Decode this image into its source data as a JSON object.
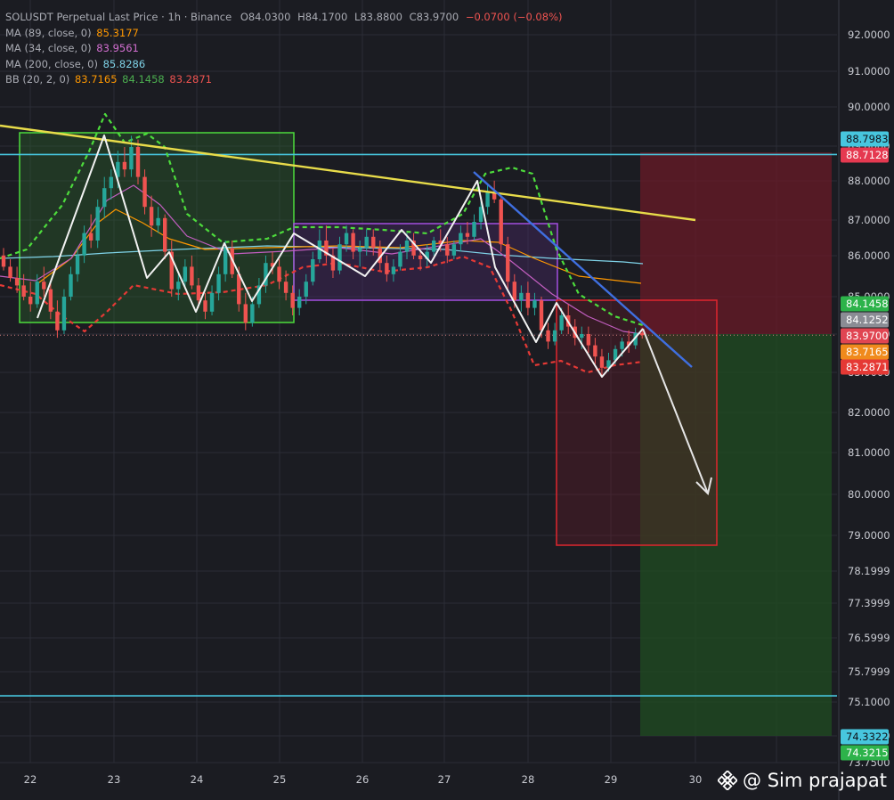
{
  "legend": {
    "title": "SOLUSDT Perpetual Last Price · 1h · Binance",
    "open": "O84.0300",
    "high": "H84.1700",
    "low": "L83.8800",
    "close": "C83.9700",
    "change": "−0.0700 (−0.08%)",
    "ma89_label": "MA (89, close, 0)",
    "ma89_value": "85.3177",
    "ma34_label": "MA (34, close, 0)",
    "ma34_value": "83.9561",
    "ma200_label": "MA (200, close, 0)",
    "ma200_value": "85.8286",
    "bb_label": "BB (20, 2, 0)",
    "bb_basis": "83.7165",
    "bb_upper": "84.1458",
    "bb_lower": "83.2871"
  },
  "watermark": {
    "icon": "binance-logo-icon",
    "text": "@ Sim prajapat"
  },
  "colors": {
    "background": "#1b1c22",
    "grid": "#2b2d36",
    "up": "#26a69a",
    "down": "#ef5350",
    "ma89": "#ff9800",
    "ma34": "#c25ec0",
    "ma200": "#7fd3e8",
    "bb_upper": "#4caf50",
    "bb_lower": "#e53935",
    "trend_yellow": "#e8dc4a",
    "trend_blue": "#3f6fe0",
    "level_cyan": "#47c6de"
  },
  "chart_data": {
    "type": "candlestick",
    "symbol": "SOLUSDT Perpetual",
    "interval": "1h",
    "exchange": "Binance",
    "ylim": [
      73.75,
      92.5
    ],
    "y_ticks": [
      "92.0000",
      "91.0000",
      "90.0000",
      "89.0000",
      "88.0000",
      "87.0000",
      "86.0000",
      "85.0000",
      "84.0000",
      "83.0000",
      "82.0000",
      "81.0000",
      "80.0000",
      "79.0000",
      "78.1999",
      "77.3999",
      "76.5999",
      "75.7999",
      "75.1000",
      "74.3000",
      "73.7500"
    ],
    "x_ticks": [
      "22",
      "23",
      "24",
      "25",
      "26",
      "27",
      "28",
      "29",
      "30"
    ],
    "price_tags": [
      {
        "label": "88.7983",
        "price": 88.7983,
        "color": "#47c6de",
        "text_color": "#10131a"
      },
      {
        "label": "88.7128",
        "price": 88.7128,
        "color": "#e53950",
        "text_color": "#ffffff"
      },
      {
        "label": "84.1458",
        "price": 84.1458,
        "color": "#2db34a",
        "text_color": "#ffffff"
      },
      {
        "label": "84.1252",
        "price": 84.1252,
        "color": "#8a8c94",
        "text_color": "#ffffff"
      },
      {
        "label": "83.9700",
        "price": 83.97,
        "color": "#e04552",
        "text_color": "#ffffff"
      },
      {
        "label": "83.7165",
        "price": 83.7165,
        "color": "#f08a1c",
        "text_color": "#ffffff"
      },
      {
        "label": "83.2871",
        "price": 83.2871,
        "color": "#e53935",
        "text_color": "#ffffff"
      },
      {
        "label": "74.3322",
        "price": 74.3322,
        "color": "#47c6de",
        "text_color": "#10131a"
      },
      {
        "label": "74.3215",
        "price": 74.3215,
        "color": "#2db34a",
        "text_color": "#ffffff"
      }
    ],
    "horizontal_levels": [
      88.7983,
      74.3322
    ],
    "last_price": 83.97,
    "candles": [
      [
        86.1,
        86.3,
        85.7,
        85.8
      ],
      [
        85.8,
        86.0,
        85.4,
        85.5
      ],
      [
        85.5,
        85.8,
        85.1,
        85.3
      ],
      [
        85.3,
        85.6,
        84.9,
        85.0
      ],
      [
        85.0,
        85.4,
        84.6,
        84.8
      ],
      [
        84.8,
        85.6,
        84.7,
        85.4
      ],
      [
        85.4,
        85.8,
        85.0,
        85.2
      ],
      [
        85.2,
        85.4,
        84.4,
        84.6
      ],
      [
        84.6,
        84.9,
        83.9,
        84.1
      ],
      [
        84.1,
        85.2,
        84.0,
        85.0
      ],
      [
        85.0,
        85.8,
        84.9,
        85.6
      ],
      [
        85.6,
        86.3,
        85.4,
        86.1
      ],
      [
        86.1,
        86.9,
        85.9,
        86.7
      ],
      [
        86.7,
        87.2,
        86.3,
        86.5
      ],
      [
        86.5,
        87.6,
        86.3,
        87.4
      ],
      [
        87.4,
        88.2,
        87.1,
        87.9
      ],
      [
        87.9,
        88.4,
        87.6,
        88.2
      ],
      [
        88.2,
        88.9,
        87.9,
        88.6
      ],
      [
        88.6,
        89.0,
        88.2,
        88.4
      ],
      [
        88.4,
        89.3,
        88.2,
        89.0
      ],
      [
        89.0,
        89.2,
        88.0,
        88.2
      ],
      [
        88.2,
        88.4,
        87.2,
        87.4
      ],
      [
        87.4,
        87.7,
        86.6,
        86.9
      ],
      [
        86.9,
        87.4,
        86.7,
        87.1
      ],
      [
        87.1,
        87.2,
        86.0,
        86.2
      ],
      [
        86.2,
        86.5,
        85.0,
        85.2
      ],
      [
        85.2,
        85.6,
        84.9,
        85.4
      ],
      [
        85.4,
        86.0,
        85.2,
        85.8
      ],
      [
        85.8,
        86.1,
        85.2,
        85.3
      ],
      [
        85.3,
        85.5,
        84.7,
        84.9
      ],
      [
        84.9,
        85.1,
        84.4,
        84.6
      ],
      [
        84.6,
        85.3,
        84.5,
        85.1
      ],
      [
        85.1,
        85.8,
        84.9,
        85.6
      ],
      [
        85.6,
        86.5,
        85.4,
        86.3
      ],
      [
        86.3,
        86.5,
        85.5,
        85.6
      ],
      [
        85.6,
        85.8,
        84.6,
        84.8
      ],
      [
        84.8,
        85.1,
        84.1,
        84.3
      ],
      [
        84.3,
        85.0,
        84.2,
        84.8
      ],
      [
        84.8,
        85.5,
        84.7,
        85.3
      ],
      [
        85.3,
        86.1,
        85.1,
        85.9
      ],
      [
        85.9,
        86.2,
        85.6,
        85.8
      ],
      [
        85.8,
        86.0,
        85.2,
        85.4
      ],
      [
        85.4,
        85.7,
        84.9,
        85.1
      ],
      [
        85.1,
        85.3,
        84.5,
        84.7
      ],
      [
        84.7,
        85.2,
        84.5,
        85.0
      ],
      [
        85.0,
        85.6,
        84.8,
        85.4
      ],
      [
        85.4,
        86.2,
        85.3,
        86.0
      ],
      [
        86.0,
        86.8,
        85.9,
        86.5
      ],
      [
        86.5,
        86.9,
        85.9,
        86.1
      ],
      [
        86.1,
        86.3,
        85.5,
        85.7
      ],
      [
        85.7,
        86.6,
        85.6,
        86.4
      ],
      [
        86.4,
        86.9,
        86.2,
        86.7
      ],
      [
        86.7,
        86.8,
        86.0,
        86.2
      ],
      [
        86.2,
        86.5,
        85.8,
        86.3
      ],
      [
        86.3,
        86.8,
        86.1,
        86.6
      ],
      [
        86.6,
        86.8,
        86.1,
        86.3
      ],
      [
        86.3,
        86.5,
        85.7,
        85.9
      ],
      [
        85.9,
        86.1,
        85.4,
        85.6
      ],
      [
        85.6,
        86.0,
        85.4,
        85.8
      ],
      [
        85.8,
        86.4,
        85.7,
        86.2
      ],
      [
        86.2,
        86.7,
        86.0,
        86.5
      ],
      [
        86.5,
        86.7,
        86.0,
        86.1
      ],
      [
        86.1,
        86.3,
        85.7,
        86.0
      ],
      [
        86.0,
        86.4,
        85.8,
        86.2
      ],
      [
        86.2,
        86.6,
        86.1,
        86.5
      ],
      [
        86.5,
        86.8,
        86.2,
        86.4
      ],
      [
        86.4,
        86.6,
        85.9,
        86.1
      ],
      [
        86.1,
        86.5,
        86.0,
        86.4
      ],
      [
        86.4,
        86.9,
        86.2,
        86.7
      ],
      [
        86.7,
        87.0,
        86.4,
        86.6
      ],
      [
        86.6,
        87.2,
        86.5,
        87.0
      ],
      [
        87.0,
        87.6,
        86.8,
        87.4
      ],
      [
        87.4,
        88.0,
        87.2,
        87.8
      ],
      [
        87.8,
        88.1,
        87.5,
        87.6
      ],
      [
        87.6,
        87.7,
        86.2,
        86.4
      ],
      [
        86.4,
        86.6,
        85.2,
        85.4
      ],
      [
        85.4,
        85.6,
        84.7,
        84.9
      ],
      [
        84.9,
        85.3,
        84.6,
        85.1
      ],
      [
        85.1,
        85.4,
        84.5,
        84.7
      ],
      [
        84.7,
        85.1,
        84.5,
        84.9
      ],
      [
        84.9,
        85.0,
        83.9,
        84.1
      ],
      [
        84.1,
        84.3,
        83.6,
        83.8
      ],
      [
        83.8,
        84.3,
        83.7,
        84.1
      ],
      [
        84.1,
        84.7,
        84.0,
        84.5
      ],
      [
        84.5,
        84.8,
        84.0,
        84.2
      ],
      [
        84.2,
        84.4,
        83.7,
        83.9
      ],
      [
        83.9,
        84.2,
        83.6,
        84.0
      ],
      [
        84.0,
        84.2,
        83.5,
        83.7
      ],
      [
        83.7,
        83.9,
        83.2,
        83.4
      ],
      [
        83.4,
        83.6,
        82.9,
        83.1
      ],
      [
        83.1,
        83.5,
        83.0,
        83.3
      ],
      [
        83.3,
        83.7,
        83.2,
        83.6
      ],
      [
        83.6,
        83.9,
        83.4,
        83.8
      ],
      [
        83.8,
        84.1,
        83.5,
        83.7
      ],
      [
        83.7,
        84.17,
        83.6,
        84.03
      ],
      [
        84.03,
        84.17,
        83.88,
        83.97
      ]
    ],
    "drawings": [
      {
        "type": "rectangle",
        "name": "range-box-green",
        "color": "#4ddc3c"
      },
      {
        "type": "rectangle",
        "name": "range-box-purple",
        "color": "#a34fe0"
      },
      {
        "type": "rectangle",
        "name": "target-box-red",
        "color": "#e0262e"
      },
      {
        "type": "trendline",
        "name": "trendline-yellow",
        "color": "#e8dc4a"
      },
      {
        "type": "trendline",
        "name": "trendline-blue",
        "color": "#3f6fe0"
      },
      {
        "type": "zigzag",
        "name": "zigzag-white",
        "color": "#f2f2f2"
      },
      {
        "type": "arrow",
        "name": "projection-arrow",
        "color": "#e6e6e6"
      },
      {
        "type": "position",
        "name": "short-position",
        "stop_color": "#7a1f2a",
        "target_color": "#1e4a22"
      }
    ]
  }
}
